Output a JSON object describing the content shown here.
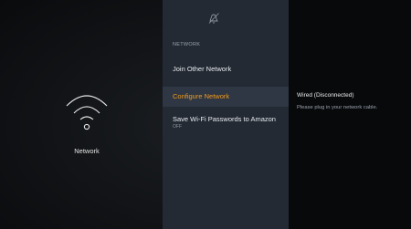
{
  "left": {
    "icon": "wifi-icon",
    "label": "Network"
  },
  "menu": {
    "top_icon": "mute-icon",
    "section_header": "NETWORK",
    "items": [
      {
        "label": "Join Other Network"
      },
      {
        "label": "Configure Network",
        "selected": true
      },
      {
        "label": "Save Wi-Fi Passwords to Amazon",
        "sub": "OFF"
      }
    ]
  },
  "detail": {
    "title": "Wired (Disconnected)",
    "description": "Please plug in your network cable."
  },
  "colors": {
    "accent": "#f39a1e",
    "menu_bg": "#232a34",
    "selected_bg": "#2e3743",
    "detail_bg": "#08090b"
  }
}
